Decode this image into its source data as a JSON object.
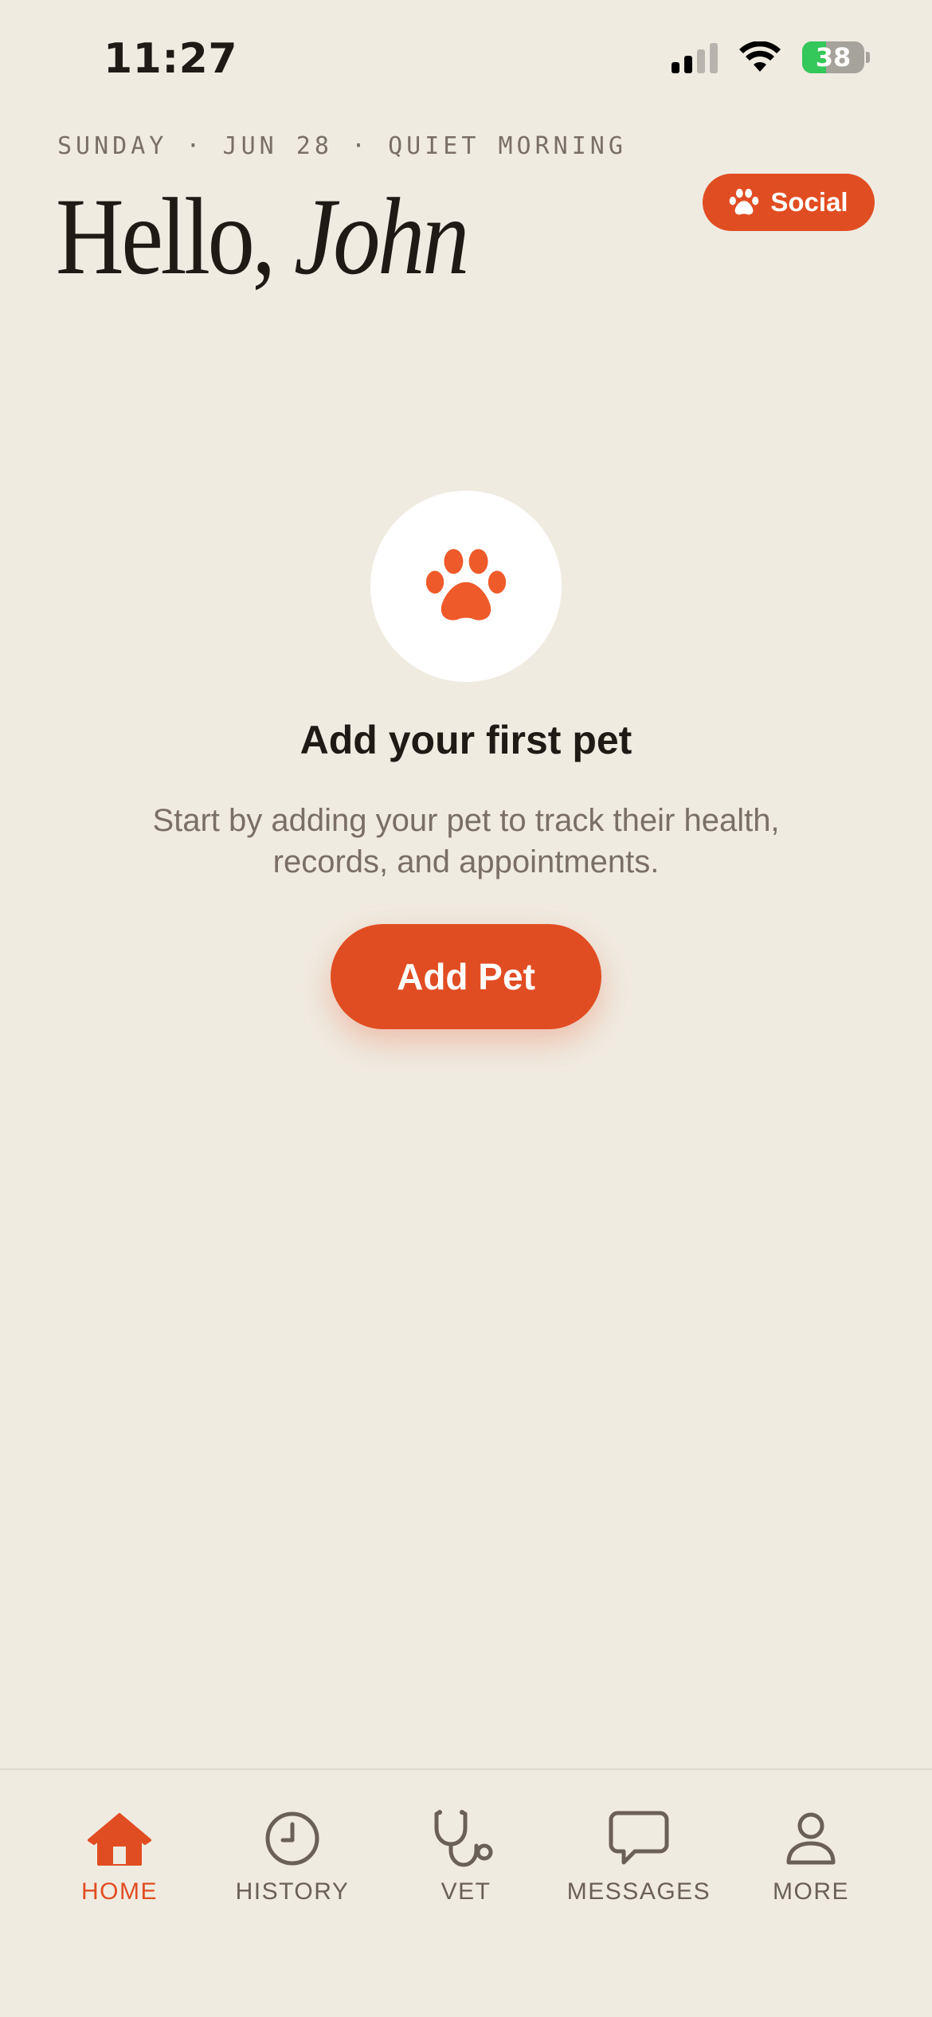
{
  "status_bar": {
    "time": "11:27",
    "battery": "38",
    "battery_level": 0.38
  },
  "header": {
    "date_line": "SUNDAY · JUN 28 · QUIET MORNING",
    "greeting": "Hello,",
    "name": "John",
    "social_label": "Social"
  },
  "empty_state": {
    "title": "Add your first pet",
    "description": "Start by adding your pet to track their health, records, and appointments.",
    "button_label": "Add Pet"
  },
  "tabs": [
    {
      "label": "HOME",
      "icon": "home-icon",
      "active": true
    },
    {
      "label": "HISTORY",
      "icon": "clock-icon",
      "active": false
    },
    {
      "label": "VET",
      "icon": "stethoscope-icon",
      "active": false
    },
    {
      "label": "MESSAGES",
      "icon": "chat-bubble-icon",
      "active": false
    },
    {
      "label": "MORE",
      "icon": "person-icon",
      "active": false
    }
  ],
  "colors": {
    "accent": "#E14D22",
    "background": "#F0EBE1",
    "text_primary": "#1F1A15",
    "text_secondary": "#7A6F66"
  }
}
